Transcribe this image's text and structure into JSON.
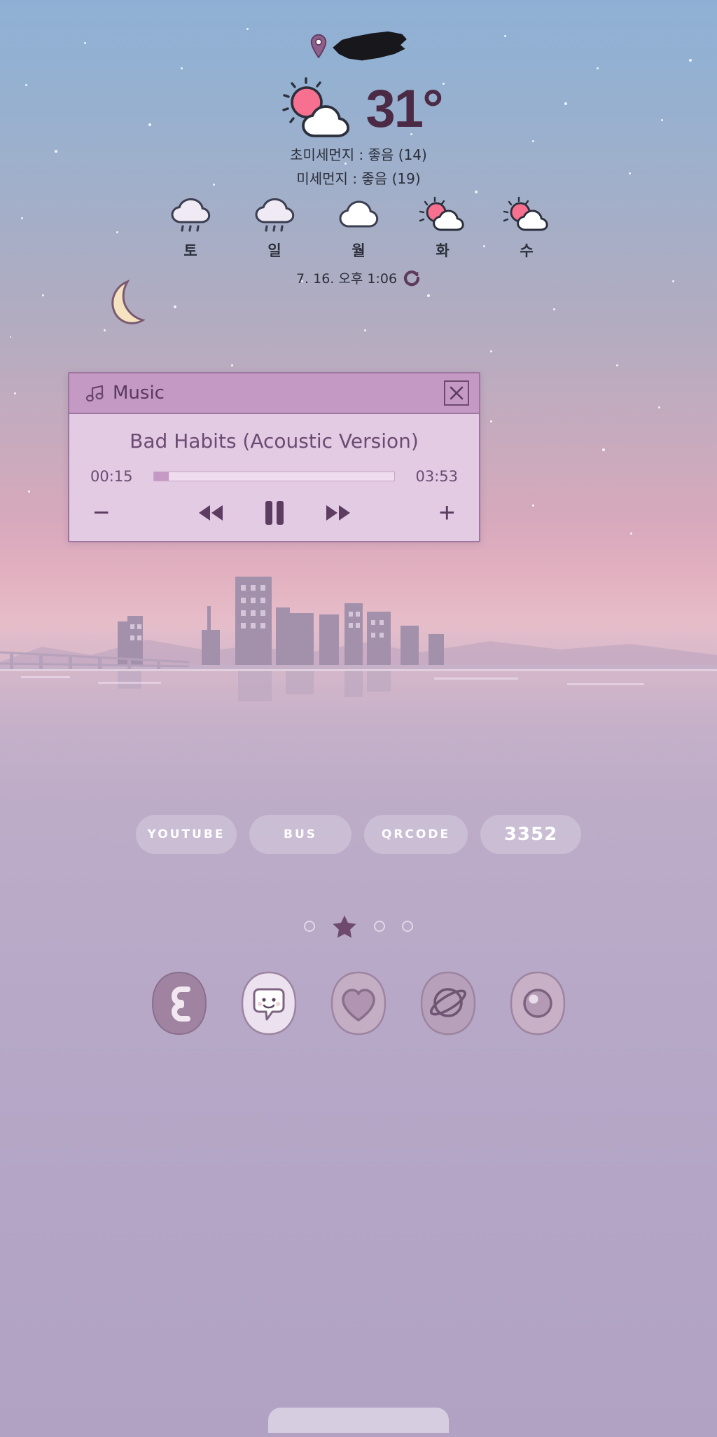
{
  "weather": {
    "location_redacted": true,
    "pin_icon": "location-pin-icon",
    "condition_icon": "sun-behind-cloud-icon",
    "temperature": "31°",
    "fine_dust_ultra": "초미세먼지 : 좋음 (14)",
    "fine_dust": "미세먼지 : 좋음 (19)",
    "updated_at": "7. 16. 오후 1:06",
    "refresh_icon": "refresh-icon",
    "forecast": [
      {
        "day": "토",
        "icon": "rain-cloud-icon"
      },
      {
        "day": "일",
        "icon": "rain-cloud-icon"
      },
      {
        "day": "월",
        "icon": "cloud-icon"
      },
      {
        "day": "화",
        "icon": "sun-behind-cloud-icon"
      },
      {
        "day": "수",
        "icon": "sun-behind-cloud-icon"
      }
    ]
  },
  "decor": {
    "moon_icon": "crescent-moon-icon"
  },
  "music": {
    "header_label": "Music",
    "note_icon": "music-note-icon",
    "close_icon": "close-icon",
    "track_title": "Bad Habits (Acoustic Version)",
    "elapsed": "00:15",
    "duration": "03:53",
    "progress_percent": 6,
    "volume_down_label": "−",
    "volume_up_label": "+",
    "prev_icon": "rewind-icon",
    "play_pause_icon": "pause-icon",
    "next_icon": "fast-forward-icon"
  },
  "shortcuts": [
    {
      "label": "YOUTUBE"
    },
    {
      "label": "BUS"
    },
    {
      "label": "QRCODE"
    },
    {
      "label": "3352"
    }
  ],
  "pages": {
    "count": 4,
    "active_index": 1,
    "active_icon": "star-icon"
  },
  "dock": [
    {
      "name": "phone",
      "icon": "phone-icon"
    },
    {
      "name": "messages",
      "icon": "chat-smiley-icon"
    },
    {
      "name": "gallery",
      "icon": "heart-icon"
    },
    {
      "name": "browser",
      "icon": "planet-icon"
    },
    {
      "name": "camera",
      "icon": "camera-icon"
    }
  ],
  "colors": {
    "accent": "#c49ac4",
    "widget_body": "#e3cbe4",
    "text_dark": "#4b2a46",
    "sky_top": "#8fb0d4"
  }
}
